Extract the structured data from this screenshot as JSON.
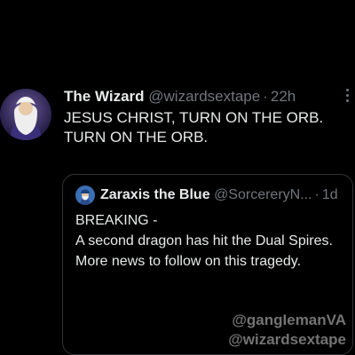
{
  "tweet": {
    "name": "The Wizard",
    "handle": "@wizardsextape",
    "separator": "·",
    "time": "22h",
    "text": "JESUS CHRIST, TURN ON THE ORB. TURN ON THE ORB.",
    "quote": {
      "name": "Zaraxis the Blue",
      "handle": "@SorcereryN...",
      "separator": "·",
      "time": "1d",
      "lines": [
        "BREAKING -",
        "A second dragon has hit the Dual Spires.",
        "More news to follow on this tragedy."
      ]
    }
  },
  "watermark": {
    "line1": "@gangIemanVA",
    "line2": "@wizardsextape"
  },
  "icons": {
    "avatar": "wizard-avatar",
    "quote_avatar": "blue-wizard-avatar",
    "more": "more-options-icon"
  }
}
